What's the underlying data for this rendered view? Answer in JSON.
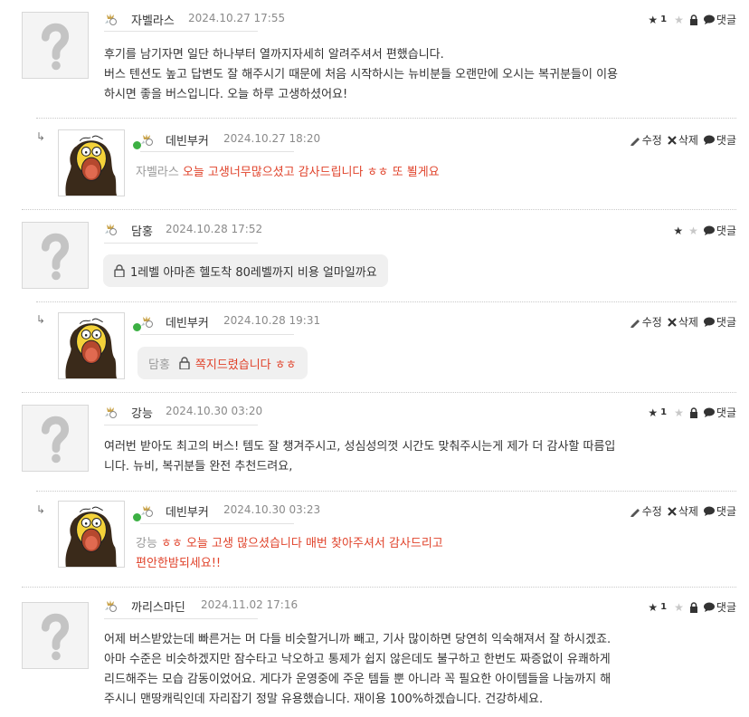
{
  "comments": [
    {
      "author": "자벨라스",
      "level": "2",
      "date": "2024.10.27 17:55",
      "stars": "1",
      "lines": [
        "후기를 남기자면 일단 하나부터 열까지자세히 알려주셔서 편했습니다.",
        "버스 텐션도 높고 답변도 잘 해주시기 때문에 처음 시작하시는 뉴비분들 오랜만에 오시는 복귀분들이 이용",
        "하시면 좋을 버스입니다. 오늘 하루 고생하셨어요!"
      ],
      "reply": {
        "author": "데빈부커",
        "level": "3",
        "date": "2024.10.27 18:20",
        "to": "자벨라스",
        "text": "오늘 고생너무많으셨고 감사드립니다 ㅎㅎ 또 뵐게요"
      }
    },
    {
      "author": "담홍",
      "level": "1",
      "date": "2024.10.28 17:52",
      "stars": "",
      "secret": "1레벨 아마존 헬도착 80레벨까지 비용 얼마일까요",
      "reply": {
        "author": "데빈부커",
        "level": "3",
        "date": "2024.10.28 19:31",
        "to": "담홍",
        "text": "쪽지드렸습니다 ㅎㅎ"
      }
    },
    {
      "author": "강능",
      "level": "1",
      "date": "2024.10.30 03:20",
      "stars": "1",
      "lines": [
        "여러번 받아도 최고의 버스! 템도 잘 챙겨주시고, 성심성의껏 시간도 맞춰주시는게 제가 더 감사할 따름입",
        "니다. 뉴비, 복귀분들 완전 추천드려요,"
      ],
      "reply": {
        "author": "데빈부커",
        "level": "3",
        "date": "2024.10.30 03:23",
        "to": "강능",
        "text": "ㅎㅎ 오늘 고생 많으셨습니다 매번 찾아주셔서 감사드리고",
        "text2": "편안한밤되세요!!"
      }
    },
    {
      "author": "까리스마딘",
      "level": "1",
      "date": "2024.11.02 17:16",
      "stars": "1",
      "lines": [
        "어제 버스받았는데 빠른거는 머 다들 비슷할거니까 빼고, 기사 많이하면 당연히 익숙해져서 잘 하시겠죠.",
        "아마 수준은 비슷하겠지만 잠수타고 낙오하고 통제가 쉽지 않은데도 불구하고 한번도 짜증없이 유쾌하게",
        "리드해주는 모습 감동이었어요. 게다가 운영중에 주운 템들 뿐 아니라 꼭 필요한 아이템들을 나눔까지 해",
        "주시니 맨땅캐릭인데 자리잡기 정말 유용했습니다. 재이용 100%하겠습니다. 건강하세요."
      ]
    }
  ],
  "labels": {
    "reply": "댓글",
    "edit": "수정",
    "delete": "삭제"
  },
  "icons": {
    "star": "star-icon",
    "lock": "lock-icon",
    "comment": "speech-bubble-icon",
    "pencil": "pencil-icon",
    "x": "x-icon",
    "reply_arrow": "reply-arrow-icon",
    "level": "level-badge-icon"
  },
  "colors": {
    "reply_text": "#e0422a",
    "online": "#3cb043",
    "divider": "#c9c9c9"
  }
}
